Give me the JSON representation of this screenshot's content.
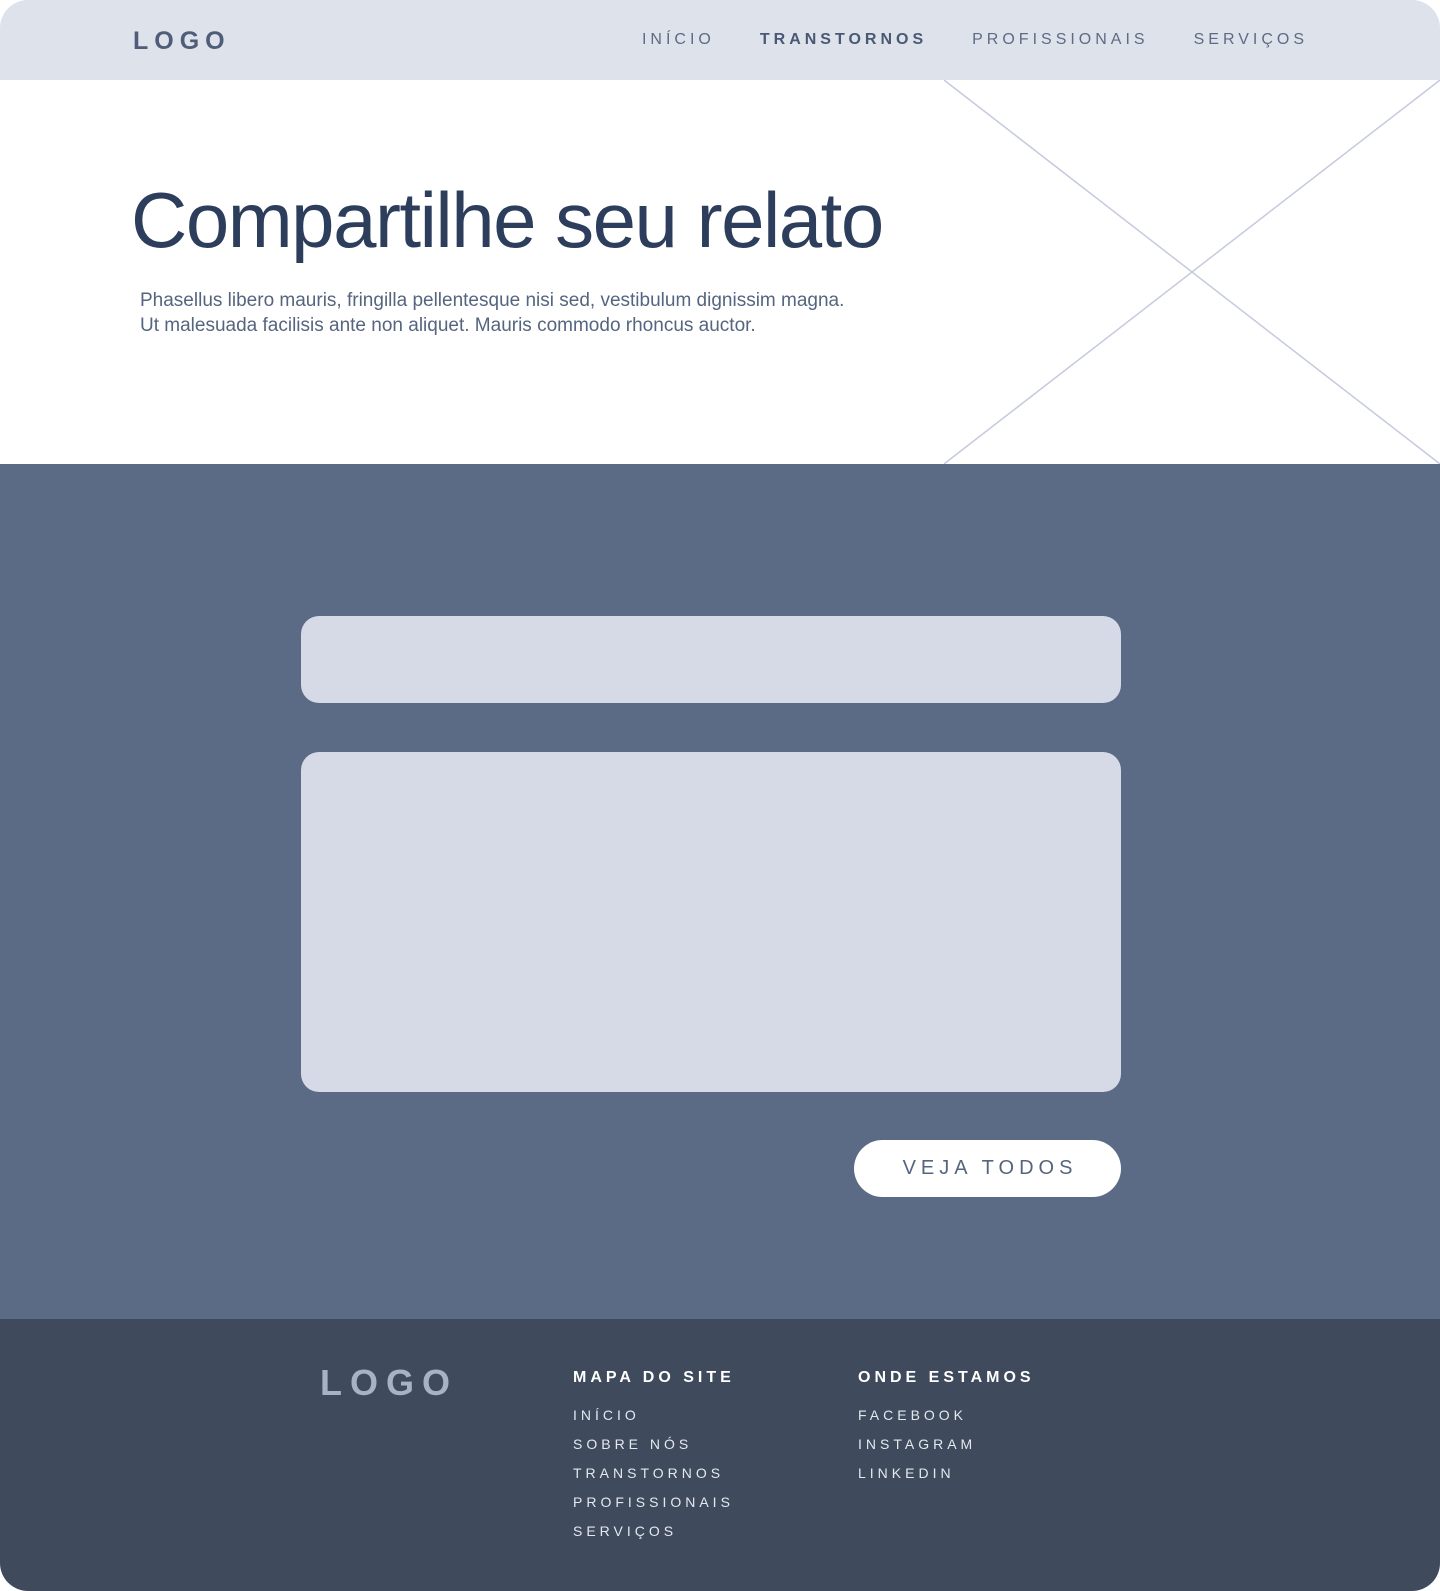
{
  "colors": {
    "navbar_bg": "#dee2eb",
    "hero_title": "#2d3e5c",
    "form_section_bg": "#5b6a85",
    "field_bg": "#d5dae6",
    "button_bg": "#ffffff",
    "footer_bg": "#3f4a5c",
    "placeholder_lines": "#c5cadd"
  },
  "navbar": {
    "logo": "LOGO",
    "links": [
      {
        "label": "INÍCIO",
        "active": false
      },
      {
        "label": "TRANSTORNOS",
        "active": true
      },
      {
        "label": "PROFISSIONAIS",
        "active": false
      },
      {
        "label": "SERVIÇOS",
        "active": false
      }
    ]
  },
  "hero": {
    "title": "Compartilhe seu relato",
    "text_line1": "Phasellus libero mauris, fringilla pellentesque nisi sed, vestibulum dignissim magna.",
    "text_line2": "Ut malesuada facilisis ante non aliquet. Mauris commodo rhoncus auctor.",
    "image_icon": "image-placeholder-icon"
  },
  "form": {
    "name_value": "",
    "message_value": "",
    "button_label": "VEJA TODOS"
  },
  "footer": {
    "logo": "LOGO",
    "sitemap": {
      "heading": "MAPA DO SITE",
      "links": [
        "INÍCIO",
        "SOBRE NÓS",
        "TRANSTORNOS",
        "PROFISSIONAIS",
        "SERVIÇOS"
      ]
    },
    "where": {
      "heading": "ONDE ESTAMOS",
      "links": [
        "FACEBOOK",
        "INSTAGRAM",
        "LINKEDIN"
      ]
    }
  }
}
